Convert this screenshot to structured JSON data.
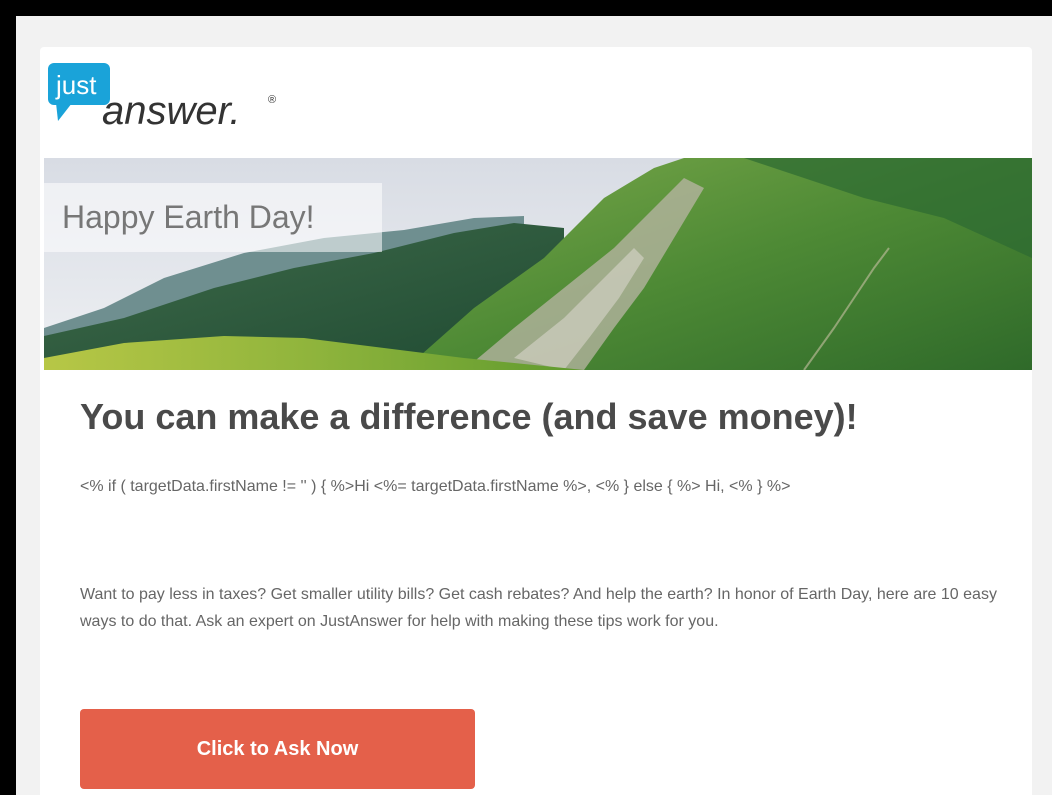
{
  "logo": {
    "badge_text": "just",
    "wordmark_text": "answer.",
    "registered_mark": "®",
    "icon": "speech-bubble-icon",
    "colors": {
      "badge": "#1aa3d9",
      "wordmark": "#333333"
    }
  },
  "hero": {
    "label": "Happy Earth Day!",
    "image": "mountain-landscape-image"
  },
  "content": {
    "headline": "You can make a difference (and save money)!",
    "greeting_template": "<% if ( targetData.firstName != '' ) { %>Hi <%= targetData.firstName %>, <% } else { %> Hi, <% } %>",
    "intro": "Want to pay less in taxes? Get smaller utility bills? Get cash rebates? And help the earth? In honor of Earth Day, here are 10 easy ways to do that. Ask an expert on JustAnswer for help with making these tips work for you."
  },
  "cta": {
    "label": "Click to Ask Now",
    "color": "#e4604a"
  }
}
